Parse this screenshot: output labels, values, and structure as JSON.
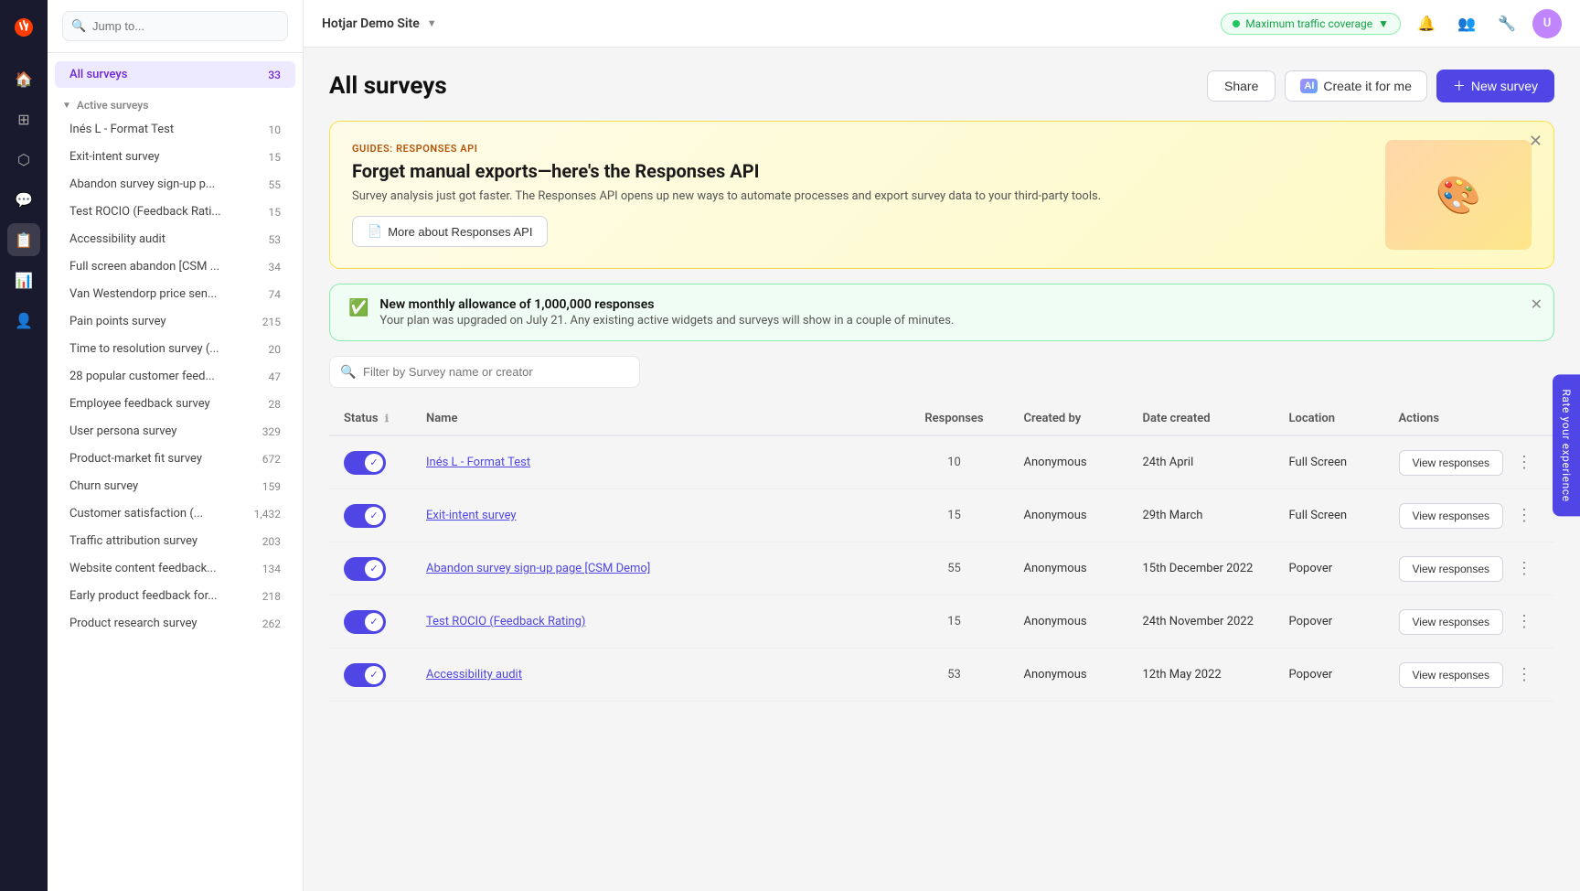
{
  "app": {
    "logo_text": "hotjar",
    "site_name": "Hotjar Demo Site",
    "traffic_coverage": "Maximum traffic coverage"
  },
  "topbar_icons": [
    "🔔",
    "👥",
    "🔧",
    "👤"
  ],
  "sidebar": {
    "search_placeholder": "Jump to...",
    "all_surveys_label": "All surveys",
    "all_surveys_count": "33",
    "active_section_label": "Active surveys",
    "items": [
      {
        "name": "Inés L - Format Test",
        "count": "10"
      },
      {
        "name": "Exit-intent survey",
        "count": "15"
      },
      {
        "name": "Abandon survey sign-up p...",
        "count": "55"
      },
      {
        "name": "Test ROCIO (Feedback Rati...",
        "count": "15"
      },
      {
        "name": "Accessibility audit",
        "count": "53"
      },
      {
        "name": "Full screen abandon [CSM ...",
        "count": "34"
      },
      {
        "name": "Van Westendorp price sen...",
        "count": "74"
      },
      {
        "name": "Pain points survey",
        "count": "215"
      },
      {
        "name": "Time to resolution survey (...",
        "count": "20"
      },
      {
        "name": "28 popular customer feed...",
        "count": "47"
      },
      {
        "name": "Employee feedback survey",
        "count": "28"
      },
      {
        "name": "User persona survey",
        "count": "329"
      },
      {
        "name": "Product-market fit survey",
        "count": "672"
      },
      {
        "name": "Churn survey",
        "count": "159"
      },
      {
        "name": "Customer satisfaction (...",
        "count": "1,432"
      },
      {
        "name": "Traffic attribution survey",
        "count": "203"
      },
      {
        "name": "Website content feedback...",
        "count": "134"
      },
      {
        "name": "Early product feedback for...",
        "count": "218"
      },
      {
        "name": "Product research survey",
        "count": "262"
      }
    ]
  },
  "page": {
    "title": "All surveys",
    "share_label": "Share",
    "ai_label": "Create it for me",
    "new_survey_label": "New survey"
  },
  "banner_api": {
    "tag": "GUIDES: RESPONSES API",
    "title": "Forget manual exports—here's the Responses API",
    "description": "Survey analysis just got faster. The Responses API opens up new ways to automate processes and export survey data to your third-party tools.",
    "button_label": "More about Responses API"
  },
  "banner_alert": {
    "title": "New monthly allowance of 1,000,000 responses",
    "description": "Your plan was upgraded on July 21. Any existing active widgets and surveys will show in a couple of minutes."
  },
  "filter": {
    "placeholder": "Filter by Survey name or creator"
  },
  "table": {
    "headers": {
      "status": "Status",
      "name": "Name",
      "responses": "Responses",
      "created_by": "Created by",
      "date_created": "Date created",
      "location": "Location",
      "actions": "Actions"
    },
    "view_responses_label": "View responses",
    "rows": [
      {
        "active": true,
        "name": "Inés L - Format Test",
        "responses": "10",
        "created_by": "Anonymous",
        "date_created": "24th April",
        "location": "Full Screen"
      },
      {
        "active": true,
        "name": "Exit-intent survey",
        "responses": "15",
        "created_by": "Anonymous",
        "date_created": "29th March",
        "location": "Full Screen"
      },
      {
        "active": true,
        "name": "Abandon survey sign-up page [CSM Demo]",
        "responses": "55",
        "created_by": "Anonymous",
        "date_created": "15th December 2022",
        "location": "Popover"
      },
      {
        "active": true,
        "name": "Test ROCIO (Feedback Rating)",
        "responses": "15",
        "created_by": "Anonymous",
        "date_created": "24th November 2022",
        "location": "Popover"
      },
      {
        "active": true,
        "name": "Accessibility audit",
        "responses": "53",
        "created_by": "Anonymous",
        "date_created": "12th May 2022",
        "location": "Popover"
      }
    ]
  },
  "feedback_tab_label": "Rate your experience"
}
